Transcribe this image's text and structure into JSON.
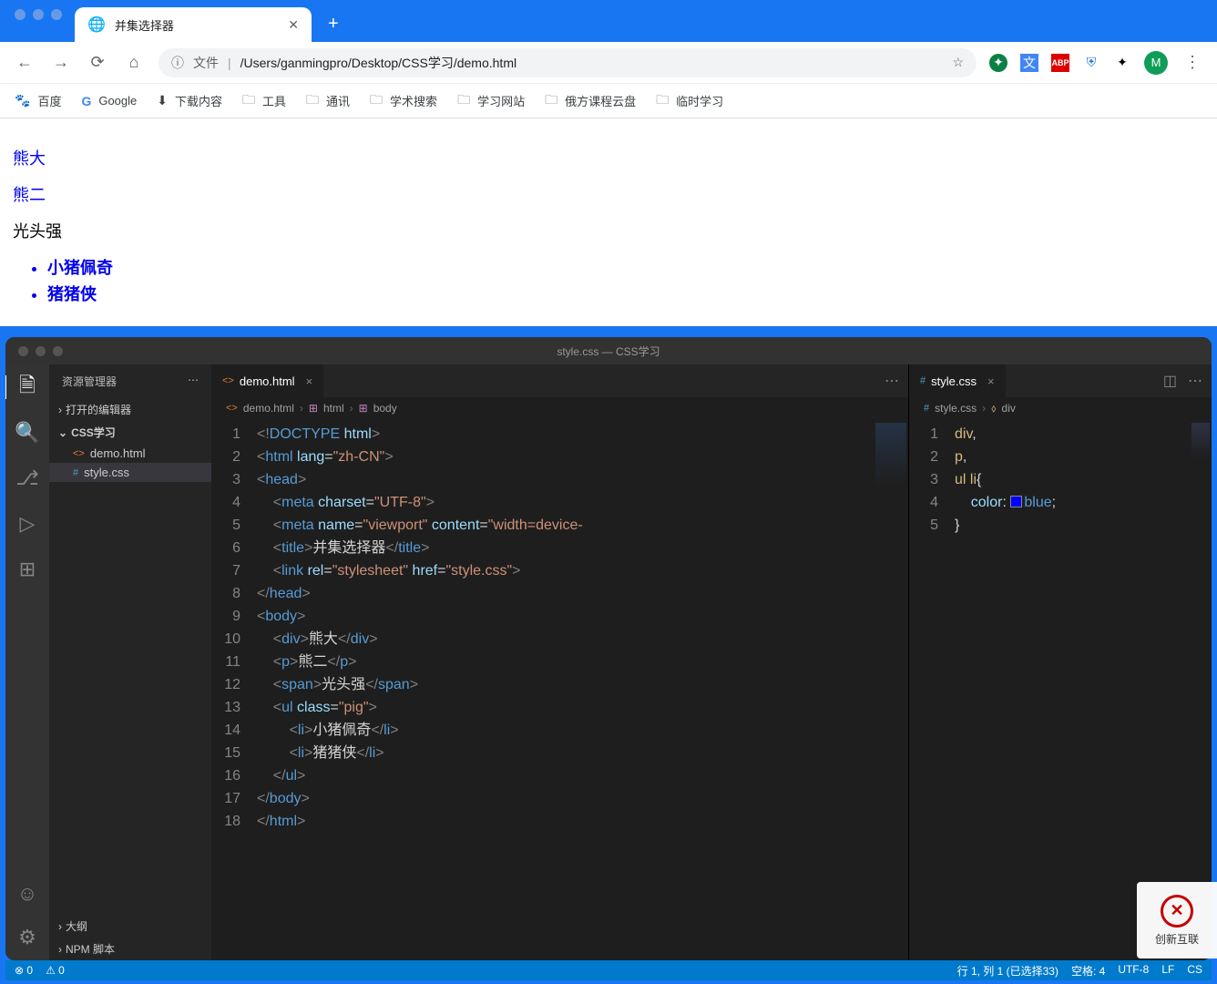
{
  "browser": {
    "tab_title": "并集选择器",
    "addr_prefix": "文件",
    "addr_path": "/Users/ganmingpro/Desktop/CSS学习/demo.html",
    "bookmarks": [
      "百度",
      "Google",
      "下载内容",
      "工具",
      "通讯",
      "学术搜索",
      "学习网站",
      "俄方课程云盘",
      "临时学习"
    ],
    "avatar": "M"
  },
  "page": {
    "div": "熊大",
    "p": "熊二",
    "span": "光头强",
    "li1": "小猪佩奇",
    "li2": "猪猪侠"
  },
  "vscode": {
    "title": "style.css — CSS学习",
    "explorer_label": "资源管理器",
    "open_editors": "打开的编辑器",
    "project": "CSS学习",
    "files": [
      "demo.html",
      "style.css"
    ],
    "outline": "大纲",
    "npm": "NPM 脚本",
    "tabs_left": "demo.html",
    "tabs_right": "style.css",
    "crumbs_left": [
      "demo.html",
      "html",
      "body"
    ],
    "crumbs_right": [
      "style.css",
      "div"
    ],
    "html_lines": [
      {
        "n": 1,
        "seg": [
          [
            "gy",
            "<!"
          ],
          [
            "tg",
            "DOCTYPE "
          ],
          [
            "at",
            "html"
          ],
          [
            "gy",
            ">"
          ]
        ]
      },
      {
        "n": 2,
        "seg": [
          [
            "gy",
            "<"
          ],
          [
            "tg",
            "html "
          ],
          [
            "at",
            "lang"
          ],
          [
            "tx",
            "="
          ],
          [
            "st",
            "\"zh-CN\""
          ],
          [
            "gy",
            ">"
          ]
        ]
      },
      {
        "n": 3,
        "seg": [
          [
            "gy",
            "<"
          ],
          [
            "tg",
            "head"
          ],
          [
            "gy",
            ">"
          ]
        ]
      },
      {
        "n": 4,
        "seg": [
          [
            "tx",
            "    "
          ],
          [
            "gy",
            "<"
          ],
          [
            "tg",
            "meta "
          ],
          [
            "at",
            "charset"
          ],
          [
            "tx",
            "="
          ],
          [
            "st",
            "\"UTF-8\""
          ],
          [
            "gy",
            ">"
          ]
        ]
      },
      {
        "n": 5,
        "seg": [
          [
            "tx",
            "    "
          ],
          [
            "gy",
            "<"
          ],
          [
            "tg",
            "meta "
          ],
          [
            "at",
            "name"
          ],
          [
            "tx",
            "="
          ],
          [
            "st",
            "\"viewport\" "
          ],
          [
            "at",
            "content"
          ],
          [
            "tx",
            "="
          ],
          [
            "st",
            "\"width=device-"
          ]
        ]
      },
      {
        "n": 6,
        "seg": [
          [
            "tx",
            "    "
          ],
          [
            "gy",
            "<"
          ],
          [
            "tg",
            "title"
          ],
          [
            "gy",
            ">"
          ],
          [
            "tx",
            "并集选择器"
          ],
          [
            "gy",
            "</"
          ],
          [
            "tg",
            "title"
          ],
          [
            "gy",
            ">"
          ]
        ]
      },
      {
        "n": 7,
        "seg": [
          [
            "tx",
            "    "
          ],
          [
            "gy",
            "<"
          ],
          [
            "tg",
            "link "
          ],
          [
            "at",
            "rel"
          ],
          [
            "tx",
            "="
          ],
          [
            "st",
            "\"stylesheet\" "
          ],
          [
            "at",
            "href"
          ],
          [
            "tx",
            "="
          ],
          [
            "st",
            "\"style.css\""
          ],
          [
            "gy",
            ">"
          ]
        ]
      },
      {
        "n": 8,
        "seg": [
          [
            "gy",
            "</"
          ],
          [
            "tg",
            "head"
          ],
          [
            "gy",
            ">"
          ]
        ]
      },
      {
        "n": 9,
        "seg": [
          [
            "gy",
            "<"
          ],
          [
            "tg",
            "body"
          ],
          [
            "gy",
            ">"
          ]
        ]
      },
      {
        "n": 10,
        "seg": [
          [
            "tx",
            "    "
          ],
          [
            "gy",
            "<"
          ],
          [
            "tg",
            "div"
          ],
          [
            "gy",
            ">"
          ],
          [
            "tx",
            "熊大"
          ],
          [
            "gy",
            "</"
          ],
          [
            "tg",
            "div"
          ],
          [
            "gy",
            ">"
          ]
        ]
      },
      {
        "n": 11,
        "seg": [
          [
            "tx",
            "    "
          ],
          [
            "gy",
            "<"
          ],
          [
            "tg",
            "p"
          ],
          [
            "gy",
            ">"
          ],
          [
            "tx",
            "熊二"
          ],
          [
            "gy",
            "</"
          ],
          [
            "tg",
            "p"
          ],
          [
            "gy",
            ">"
          ]
        ]
      },
      {
        "n": 12,
        "seg": [
          [
            "tx",
            "    "
          ],
          [
            "gy",
            "<"
          ],
          [
            "tg",
            "span"
          ],
          [
            "gy",
            ">"
          ],
          [
            "tx",
            "光头强"
          ],
          [
            "gy",
            "</"
          ],
          [
            "tg",
            "span"
          ],
          [
            "gy",
            ">"
          ]
        ]
      },
      {
        "n": 13,
        "seg": [
          [
            "tx",
            "    "
          ],
          [
            "gy",
            "<"
          ],
          [
            "tg",
            "ul "
          ],
          [
            "at",
            "class"
          ],
          [
            "tx",
            "="
          ],
          [
            "st",
            "\"pig\""
          ],
          [
            "gy",
            ">"
          ]
        ]
      },
      {
        "n": 14,
        "seg": [
          [
            "tx",
            "        "
          ],
          [
            "gy",
            "<"
          ],
          [
            "tg",
            "li"
          ],
          [
            "gy",
            ">"
          ],
          [
            "tx",
            "小猪佩奇"
          ],
          [
            "gy",
            "</"
          ],
          [
            "tg",
            "li"
          ],
          [
            "gy",
            ">"
          ]
        ]
      },
      {
        "n": 15,
        "seg": [
          [
            "tx",
            "        "
          ],
          [
            "gy",
            "<"
          ],
          [
            "tg",
            "li"
          ],
          [
            "gy",
            ">"
          ],
          [
            "tx",
            "猪猪侠"
          ],
          [
            "gy",
            "</"
          ],
          [
            "tg",
            "li"
          ],
          [
            "gy",
            ">"
          ]
        ]
      },
      {
        "n": 16,
        "seg": [
          [
            "tx",
            "    "
          ],
          [
            "gy",
            "</"
          ],
          [
            "tg",
            "ul"
          ],
          [
            "gy",
            ">"
          ]
        ]
      },
      {
        "n": 17,
        "seg": [
          [
            "gy",
            "</"
          ],
          [
            "tg",
            "body"
          ],
          [
            "gy",
            ">"
          ]
        ]
      },
      {
        "n": 18,
        "seg": [
          [
            "gy",
            "</"
          ],
          [
            "tg",
            "html"
          ],
          [
            "gy",
            ">"
          ]
        ]
      }
    ],
    "css_lines": [
      {
        "n": 1,
        "seg": [
          [
            "pc",
            "div"
          ],
          [
            "tx",
            ","
          ]
        ]
      },
      {
        "n": 2,
        "seg": [
          [
            "pc",
            "p"
          ],
          [
            "tx",
            ","
          ]
        ]
      },
      {
        "n": 3,
        "seg": [
          [
            "pc",
            "ul li"
          ],
          [
            "tx",
            "{"
          ]
        ]
      },
      {
        "n": 4,
        "seg": [
          [
            "tx",
            "    "
          ],
          [
            "pr",
            "color"
          ],
          [
            "tx",
            ": "
          ],
          [
            "box",
            ""
          ],
          [
            "kw",
            "blue"
          ],
          [
            "tx",
            ";"
          ]
        ]
      },
      {
        "n": 5,
        "seg": [
          [
            "tx",
            "}"
          ]
        ]
      }
    ],
    "status": {
      "errors": "⊗ 0",
      "warnings": "⚠ 0",
      "pos": "行 1, 列 1 (已选择33)",
      "spaces": "空格: 4",
      "enc": "UTF-8",
      "eol": "LF",
      "lang": "CS"
    }
  },
  "watermark": "创新互联"
}
